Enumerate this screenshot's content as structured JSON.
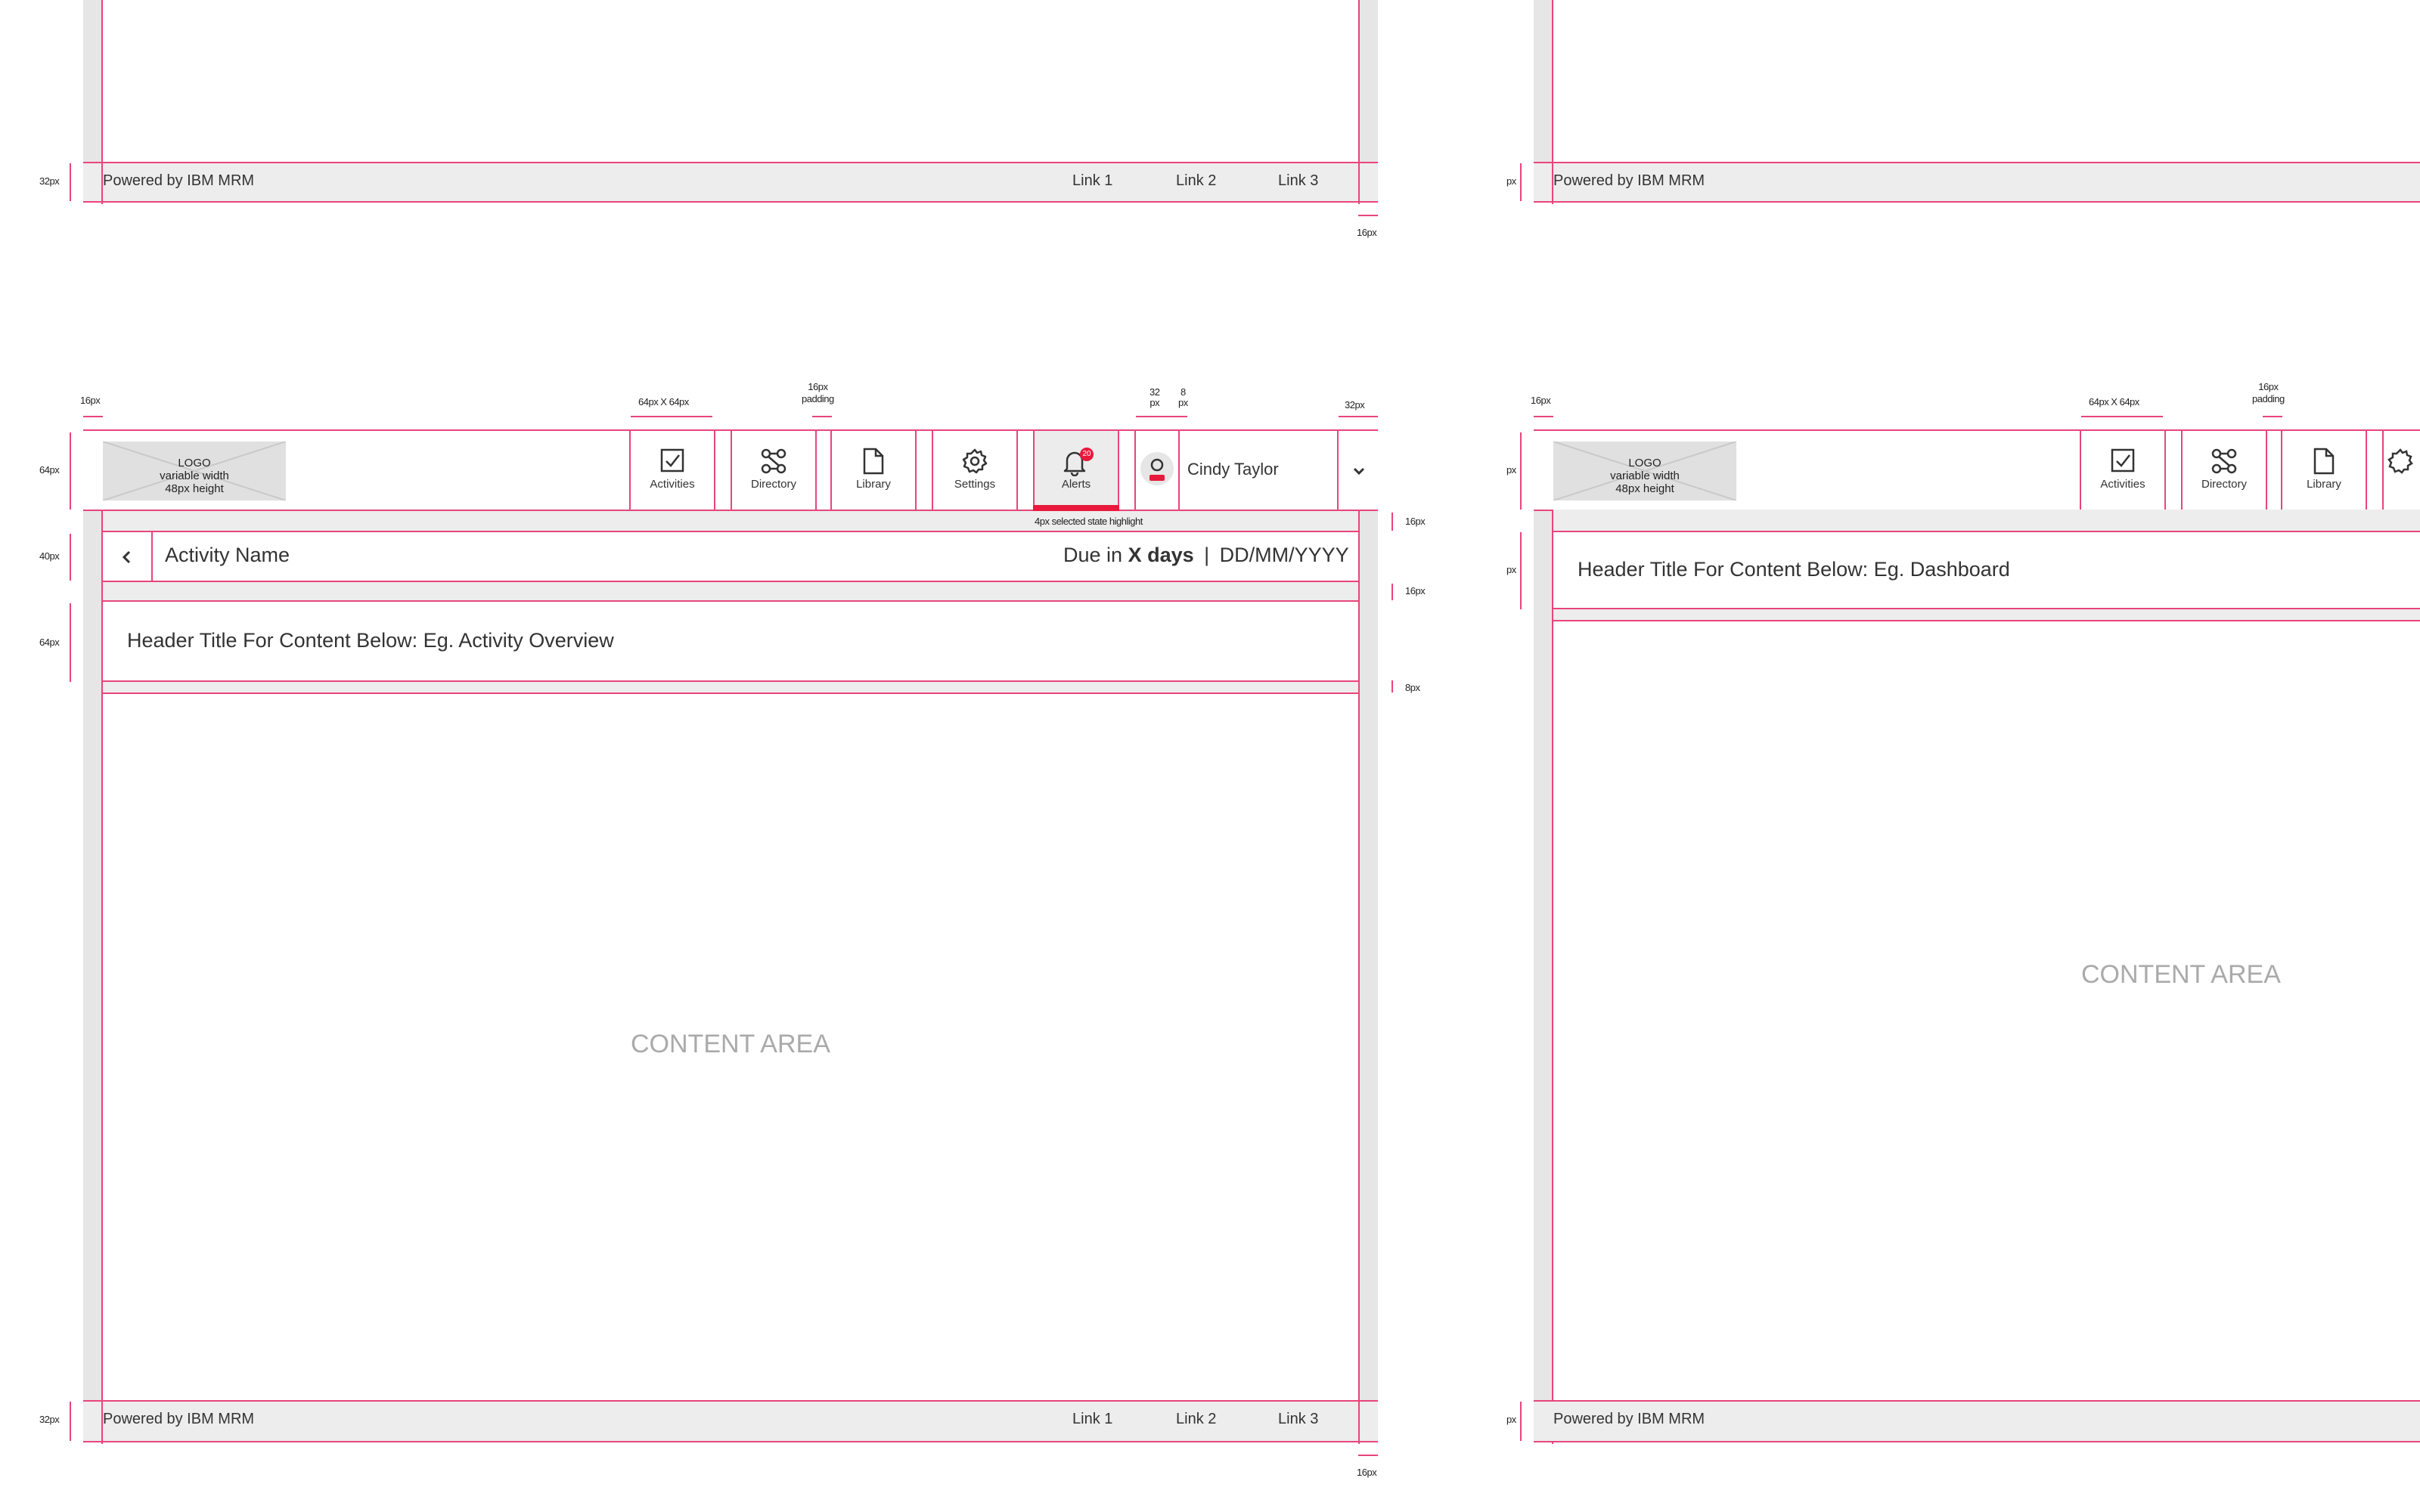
{
  "footer": {
    "powered_by": "Powered by IBM MRM",
    "link1": "Link 1",
    "link2": "Link 2",
    "link3": "Link 3"
  },
  "header": {
    "logo": {
      "line1": "LOGO",
      "line2": "variable width",
      "line3": "48px height"
    },
    "nav": [
      {
        "label": "Activities",
        "icon": "checkbox-icon"
      },
      {
        "label": "Directory",
        "icon": "directory-icon"
      },
      {
        "label": "Library",
        "icon": "document-icon"
      },
      {
        "label": "Settings",
        "icon": "gear-icon"
      },
      {
        "label": "Alerts",
        "icon": "bell-icon",
        "badge": "20"
      }
    ],
    "user_name": "Cindy Taylor"
  },
  "activity_bar": {
    "title": "Activity Name",
    "due_prefix": "Due in",
    "due_bold": "X days",
    "separator": "|",
    "date": "DD/MM/YYYY"
  },
  "page_header_left": "Header Title For Content Below: Eg. Activity Overview",
  "page_header_right": "Header Title For Content Below: Eg. Dashboard",
  "content_label": "CONTENT AREA",
  "annotations": {
    "px16": "16px",
    "px32": "32px",
    "px64": "64px",
    "px40": "40px",
    "px8": "8px",
    "px": "px",
    "nav_size": "64px X 64px",
    "padding_line1": "16px",
    "padding_line2": "padding",
    "avatar_32_line1": "32",
    "avatar_32_line2": "px",
    "avatar_8_line1": "8",
    "avatar_8_line2": "px",
    "highlight_note": "4px selected state highlight"
  },
  "colors": {
    "guide": "#e8457a",
    "accent": "#e8193c",
    "sidebar": "#e6e6e6"
  }
}
